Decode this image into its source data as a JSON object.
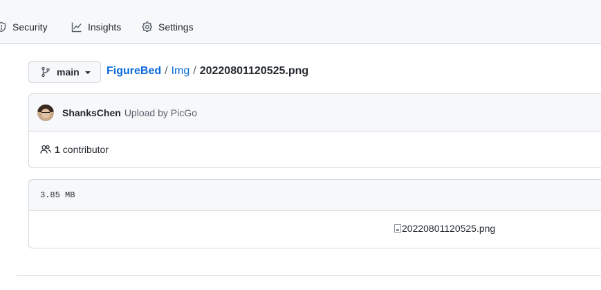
{
  "repo_nav": {
    "security_label": "Security",
    "insights_label": "Insights",
    "settings_label": "Settings"
  },
  "branch": {
    "name": "main"
  },
  "breadcrumb": {
    "repo": "FigureBed",
    "separator": "/",
    "folder": "Img",
    "file": "20220801120525.png"
  },
  "commit": {
    "author": "ShanksChen",
    "message": "Upload by PicGo"
  },
  "contributors": {
    "count": "1",
    "label": "contributor"
  },
  "file": {
    "size": "3.85 MB",
    "image_alt": "20220801120525.png"
  },
  "icons": {
    "security": "shield-icon",
    "insights": "graph-icon",
    "settings": "gear-icon",
    "branch": "git-branch-icon",
    "contributors": "people-icon"
  },
  "colors": {
    "link": "#0969da",
    "border": "#d0d7de",
    "header_bg": "#f6f8fa",
    "muted_text": "#57606a"
  }
}
